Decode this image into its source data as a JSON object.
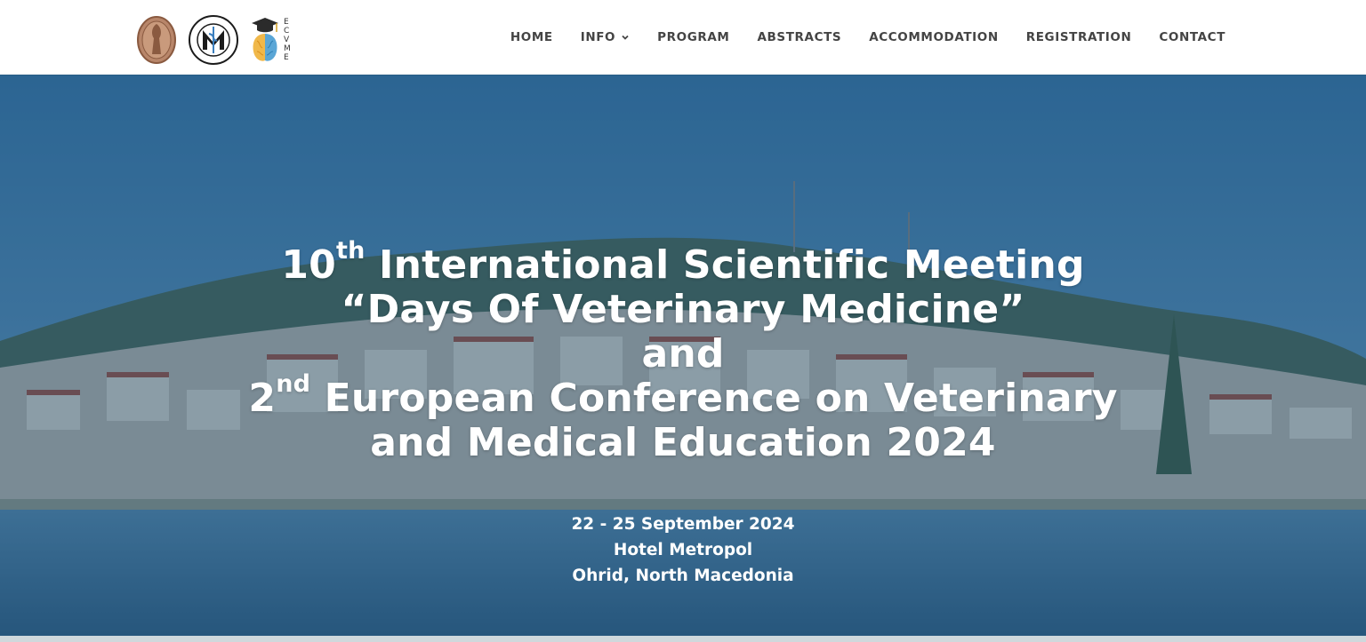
{
  "header": {
    "logos": [
      {
        "name": "university-seal-logo"
      },
      {
        "name": "faculty-veterinary-medicine-logo",
        "text": "FACULTAS MEDICINAE VETERINARIAE SKOPJE"
      },
      {
        "name": "ecvme-logo",
        "text": "ECVME"
      }
    ],
    "nav": {
      "home": "HOME",
      "info": "INFO",
      "program": "PROGRAM",
      "abstracts": "ABSTRACTS",
      "accommodation": "ACCOMMODATION",
      "registration": "REGISTRATION",
      "contact": "CONTACT"
    }
  },
  "hero": {
    "line1_num": "10",
    "line1_sup": "th",
    "line1_rest": " International Scientific Meeting",
    "line2": "“Days Of Veterinary Medicine”",
    "line3": "and",
    "line4_num": "2",
    "line4_sup": "nd",
    "line4_rest": " European Conference on Veterinary",
    "line5": "and Medical Education 2024",
    "dates": "22 - 25 September 2024",
    "venue": "Hotel Metropol",
    "location": "Ohrid, North Macedonia"
  },
  "colors": {
    "overlay": "#1a4a6e",
    "nav_text": "#444444",
    "title_text": "#ffffff"
  }
}
